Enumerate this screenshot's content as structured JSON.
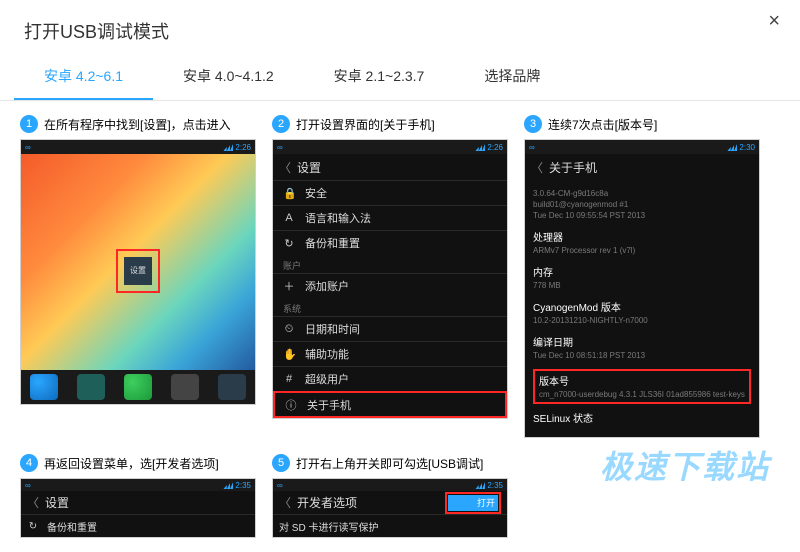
{
  "title": "打开USB调试模式",
  "close": "×",
  "tabs": [
    {
      "label": "安卓 4.2~6.1",
      "active": true
    },
    {
      "label": "安卓 4.0~4.1.2",
      "active": false
    },
    {
      "label": "安卓 2.1~2.3.7",
      "active": false
    },
    {
      "label": "选择品牌",
      "active": false
    }
  ],
  "steps": {
    "s1": {
      "num": "1",
      "text": "在所有程序中找到[设置]，点击进入",
      "icon_label": "设置",
      "time": "2:26"
    },
    "s2": {
      "num": "2",
      "text": "打开设置界面的[关于手机]",
      "head": "设置",
      "time": "2:26",
      "rows": [
        {
          "cat": false,
          "icon": "🔒",
          "label": "安全"
        },
        {
          "cat": false,
          "icon": "A",
          "label": "语言和输入法"
        },
        {
          "cat": false,
          "icon": "↻",
          "label": "备份和重置"
        },
        {
          "cat": true,
          "label": "账户"
        },
        {
          "cat": false,
          "icon": "＋",
          "label": "添加账户"
        },
        {
          "cat": true,
          "label": "系统"
        },
        {
          "cat": false,
          "icon": "⏲",
          "label": "日期和时间"
        },
        {
          "cat": false,
          "icon": "✋",
          "label": "辅助功能"
        },
        {
          "cat": false,
          "icon": "#",
          "label": "超级用户"
        },
        {
          "cat": false,
          "icon": "ⓘ",
          "label": "关于手机",
          "hl": true
        }
      ]
    },
    "s3": {
      "num": "3",
      "text": "连续7次点击[版本号]",
      "head": "关于手机",
      "time": "2:30",
      "blocks": [
        {
          "title": "",
          "subs": [
            "3.0.64-CM-g9d16c8a",
            "build01@cyanogenmod #1",
            "Tue Dec 10 09:55:54 PST 2013"
          ]
        },
        {
          "title": "处理器",
          "subs": [
            "ARMv7 Processor rev 1 (v7l)"
          ]
        },
        {
          "title": "内存",
          "subs": [
            "778 MB"
          ]
        },
        {
          "title": "CyanogenMod 版本",
          "subs": [
            "10.2-20131210-NIGHTLY-n7000"
          ]
        },
        {
          "title": "编译日期",
          "subs": [
            "Tue Dec 10 08:51:18 PST 2013"
          ]
        },
        {
          "title": "版本号",
          "subs": [
            "cm_n7000-userdebug 4.3.1 JLS36I 01ad855986 test-keys"
          ],
          "hl": true
        },
        {
          "title": "SELinux 状态",
          "subs": []
        }
      ]
    },
    "s4": {
      "num": "4",
      "text": "再返回设置菜单，选[开发者选项]",
      "head": "设置",
      "time": "2:35",
      "row": {
        "icon": "↻",
        "label": "备份和重置"
      }
    },
    "s5": {
      "num": "5",
      "text": "打开右上角开关即可勾选[USB调试]",
      "head": "开发者选项",
      "time": "2:35",
      "toggle": "打开",
      "row": "对 SD 卡进行读写保护"
    }
  },
  "watermark": "极速下载站"
}
